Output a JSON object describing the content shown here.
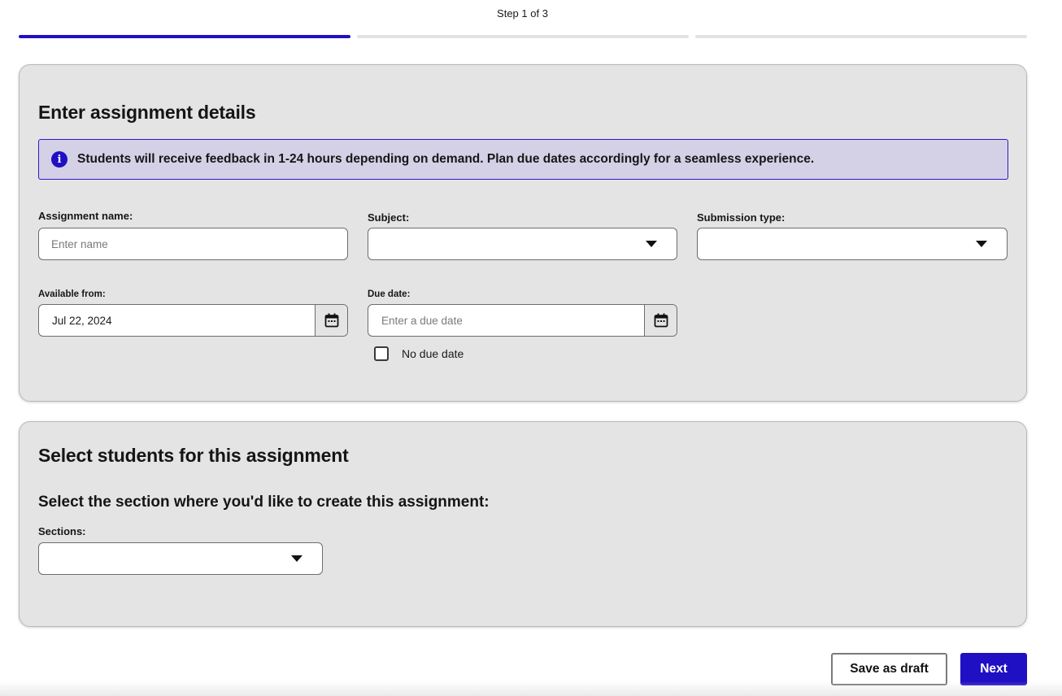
{
  "progress": {
    "step_label": "Step 1 of 3",
    "total_steps": 3,
    "current_step": 1
  },
  "details": {
    "title": "Enter assignment details",
    "info_icon": "info-icon",
    "info_text": "Students will receive feedback in 1-24 hours depending on demand. Plan due dates accordingly for a seamless experience.",
    "assignment_name": {
      "label": "Assignment name:",
      "placeholder": "Enter name",
      "value": ""
    },
    "subject": {
      "label": "Subject:",
      "value": ""
    },
    "submission_type": {
      "label": "Submission type:",
      "value": ""
    },
    "available_from": {
      "label": "Available from:",
      "value": "Jul 22, 2024"
    },
    "due_date": {
      "label": "Due date:",
      "placeholder": "Enter a due date",
      "value": ""
    },
    "no_due_date": {
      "label": "No due date",
      "checked": false
    }
  },
  "students": {
    "title": "Select students for this assignment",
    "subheading": "Select the section where you'd like to create this assignment:",
    "sections": {
      "label": "Sections:",
      "value": ""
    }
  },
  "actions": {
    "save_draft": "Save as draft",
    "next": "Next"
  },
  "colors": {
    "accent": "#1f10c4",
    "card_bg": "#e4e4e4",
    "info_bg": "#d4d1e6"
  }
}
